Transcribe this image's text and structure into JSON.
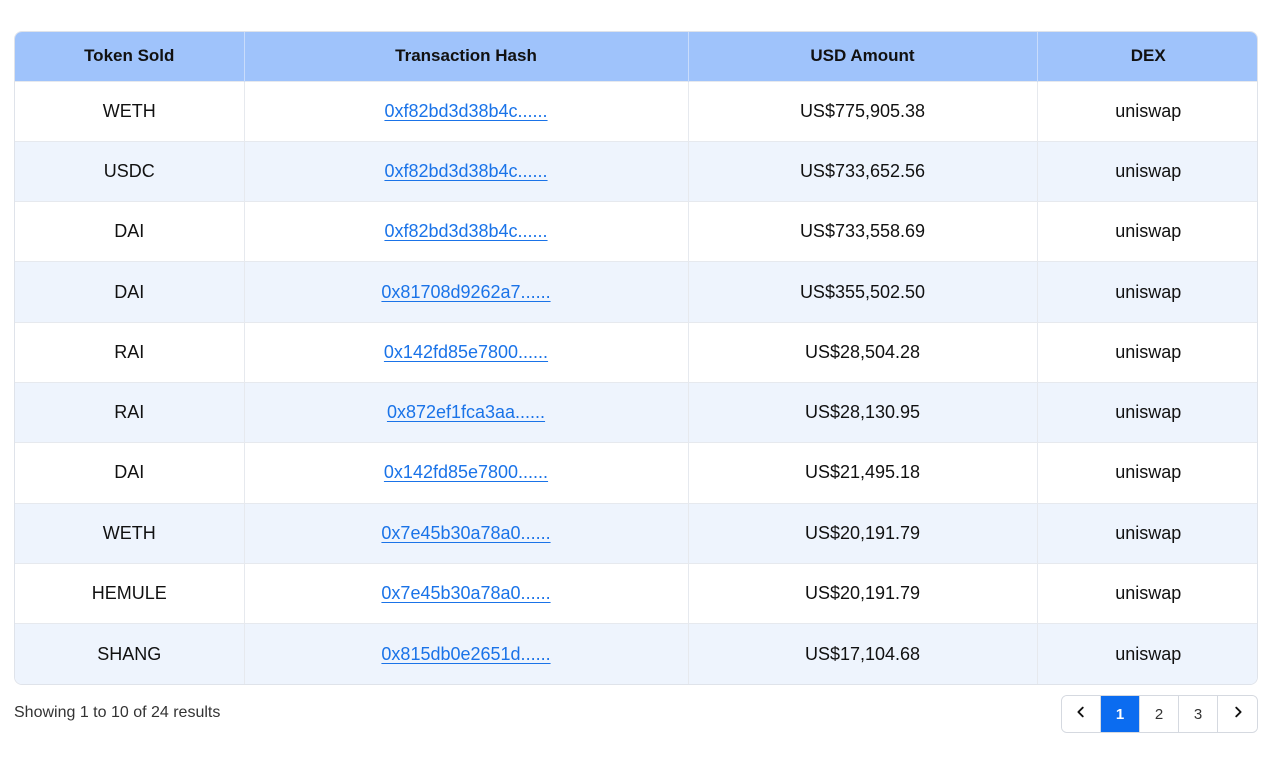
{
  "table": {
    "headers": [
      "Token Sold",
      "Transaction Hash",
      "USD Amount",
      "DEX"
    ],
    "rows": [
      {
        "token": "WETH",
        "hash": "0xf82bd3d38b4c......",
        "usd": "US$775,905.38",
        "dex": "uniswap"
      },
      {
        "token": "USDC",
        "hash": "0xf82bd3d38b4c......",
        "usd": "US$733,652.56",
        "dex": "uniswap"
      },
      {
        "token": "DAI",
        "hash": "0xf82bd3d38b4c......",
        "usd": "US$733,558.69",
        "dex": "uniswap"
      },
      {
        "token": "DAI",
        "hash": "0x81708d9262a7......",
        "usd": "US$355,502.50",
        "dex": "uniswap"
      },
      {
        "token": "RAI",
        "hash": "0x142fd85e7800......",
        "usd": "US$28,504.28",
        "dex": "uniswap"
      },
      {
        "token": "RAI",
        "hash": "0x872ef1fca3aa......",
        "usd": "US$28,130.95",
        "dex": "uniswap"
      },
      {
        "token": "DAI",
        "hash": "0x142fd85e7800......",
        "usd": "US$21,495.18",
        "dex": "uniswap"
      },
      {
        "token": "WETH",
        "hash": "0x7e45b30a78a0......",
        "usd": "US$20,191.79",
        "dex": "uniswap"
      },
      {
        "token": "HEMULE",
        "hash": "0x7e45b30a78a0......",
        "usd": "US$20,191.79",
        "dex": "uniswap"
      },
      {
        "token": "SHANG",
        "hash": "0x815db0e2651d......",
        "usd": "US$17,104.68",
        "dex": "uniswap"
      }
    ]
  },
  "footer": {
    "results_text": "Showing 1 to 10 of 24 results",
    "pages": [
      "1",
      "2",
      "3"
    ],
    "current_page": "1",
    "prev_icon": "chevron-left-icon",
    "next_icon": "chevron-right-icon"
  },
  "colors": {
    "header_bg": "#9fc3fb",
    "stripe_bg": "#eef4fd",
    "link": "#1a73e8",
    "active_page": "#0b6cf0"
  }
}
